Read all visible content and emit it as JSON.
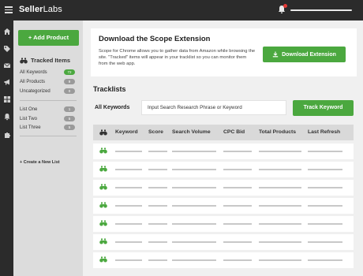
{
  "app": {
    "logo_bold": "Seller",
    "logo_light": "Labs",
    "icons": [
      "menu-icon",
      "bell-icon"
    ]
  },
  "rail": {
    "icons": [
      "home-icon",
      "tag-icon",
      "mail-icon",
      "megaphone-icon",
      "grid-icon",
      "bell-icon",
      "puzzle-icon"
    ]
  },
  "sidebar": {
    "add_product_label": "+ Add Product",
    "tracked_items_title": "Tracked Items",
    "items": [
      {
        "label": "All Keywords",
        "count": "72",
        "active": true
      },
      {
        "label": "All Products",
        "count": "9",
        "active": false
      },
      {
        "label": "Uncategorized",
        "count": "0",
        "active": false
      }
    ],
    "lists": [
      {
        "label": "List One",
        "count": "1"
      },
      {
        "label": "List Two",
        "count": "5"
      },
      {
        "label": "List Three",
        "count": "5"
      }
    ],
    "create_list_label": "+ Create a New List"
  },
  "extension": {
    "title": "Download the Scope Extension",
    "description": "Scope for Chrome allows you to gather data from Amazon while browsing the site. \"Tracked\" items will appear in your tracklist so you can monitor them from the web app.",
    "download_label": "Download Extension"
  },
  "tracklists": {
    "title": "Tracklists",
    "filter_label": "All Keywords",
    "search_placeholder": "Input Search Research Phrase or Keyword",
    "track_label": "Track Keyword"
  },
  "table": {
    "columns": [
      "Keyword",
      "Score",
      "Search Volume",
      "CPC Bid",
      "Total Products",
      "Last Refresh"
    ],
    "row_count": 7
  },
  "colors": {
    "accent_green": "#4ba83f",
    "dark_bar": "#2b2b2b",
    "notification_red": "#e53935"
  }
}
